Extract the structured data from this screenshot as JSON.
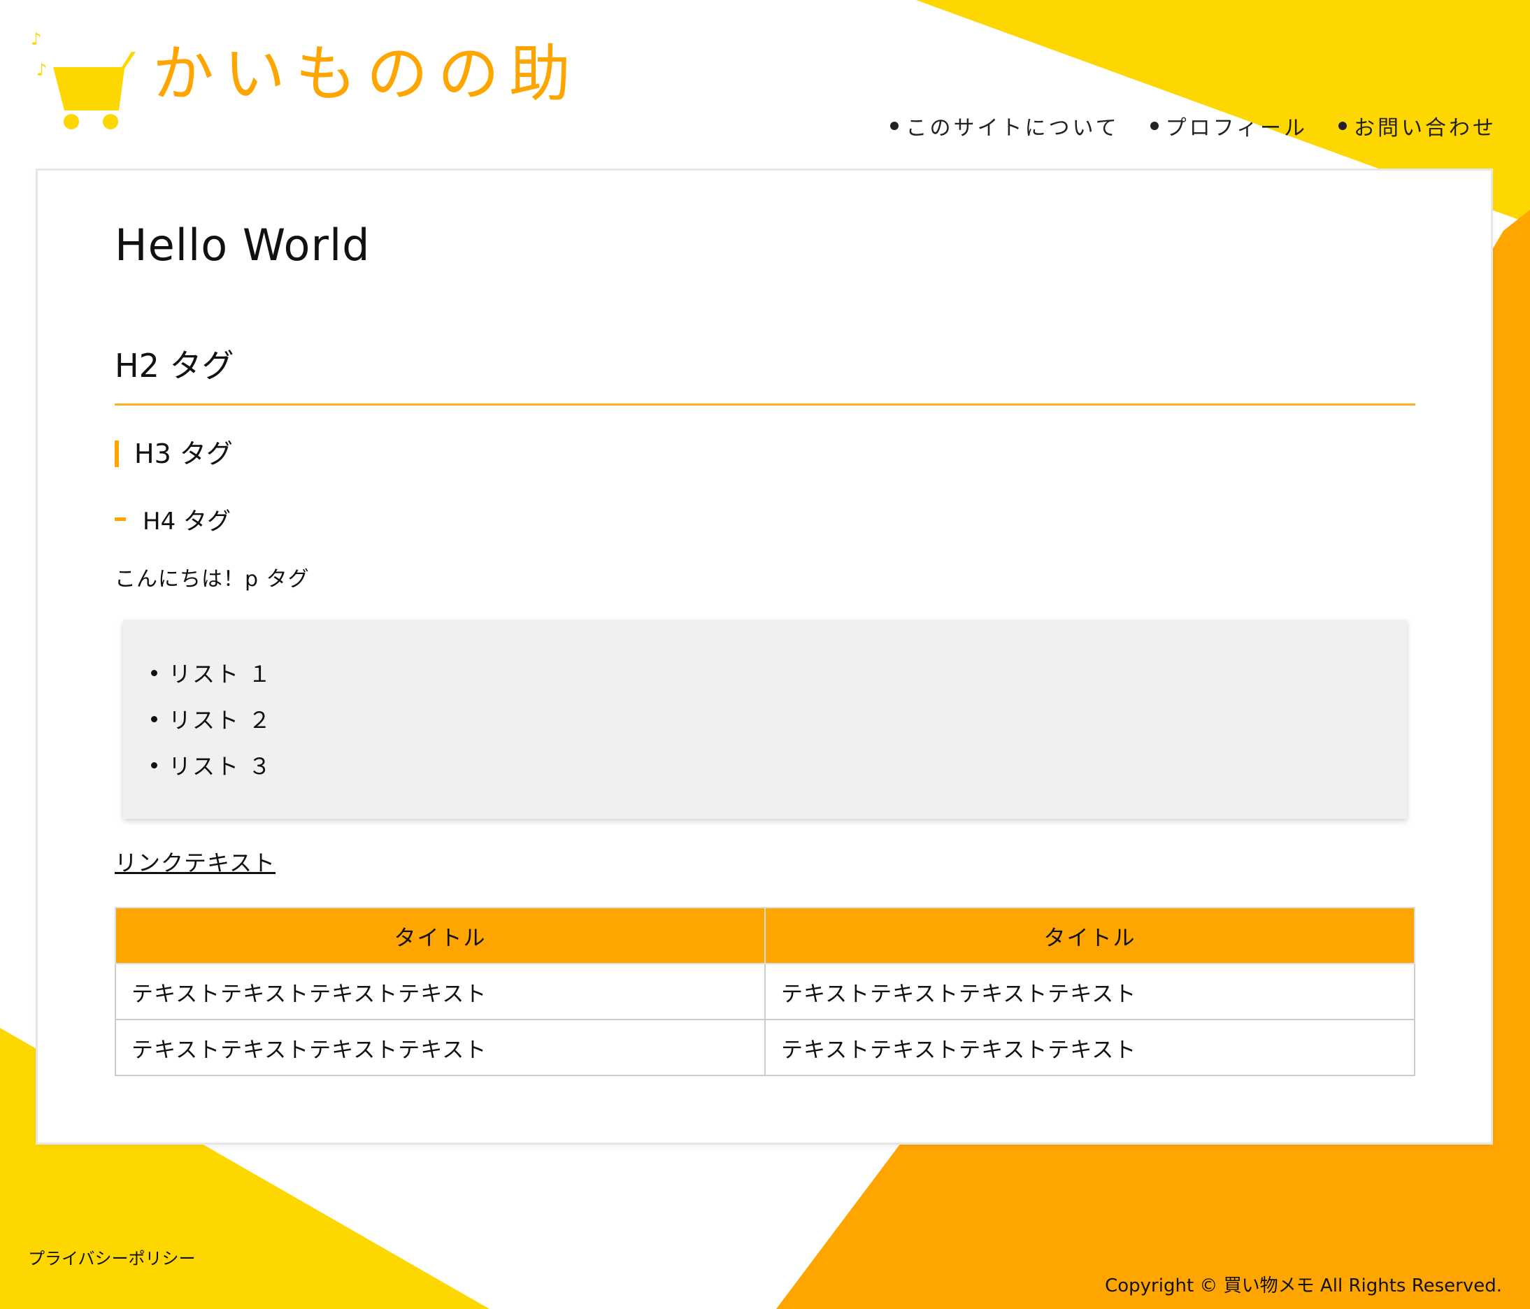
{
  "brand": {
    "logo_text": "かいものの助",
    "accent_color": "#FFA500",
    "yellow_color": "#FFD700",
    "logo_icon": "shopping-cart-icon"
  },
  "nav": {
    "items": [
      {
        "label": "このサイトについて"
      },
      {
        "label": "プロフィール"
      },
      {
        "label": "お問い合わせ"
      }
    ]
  },
  "main": {
    "h1": "Hello World",
    "h2": "H2 タグ",
    "h3": "H3 タグ",
    "h4": "H4 タグ",
    "paragraph": "こんにちは！p タグ",
    "list": [
      "リスト １",
      "リスト ２",
      "リスト ３"
    ],
    "link_text": "リンクテキスト",
    "table": {
      "headers": [
        "タイトル",
        "タイトル"
      ],
      "rows": [
        [
          "テキストテキストテキストテキスト",
          "テキストテキストテキストテキスト"
        ],
        [
          "テキストテキストテキストテキスト",
          "テキストテキストテキストテキスト"
        ]
      ]
    }
  },
  "footer": {
    "privacy": "プライバシーポリシー",
    "copyright": "Copyright © 買い物メモ All Rights Reserved."
  }
}
